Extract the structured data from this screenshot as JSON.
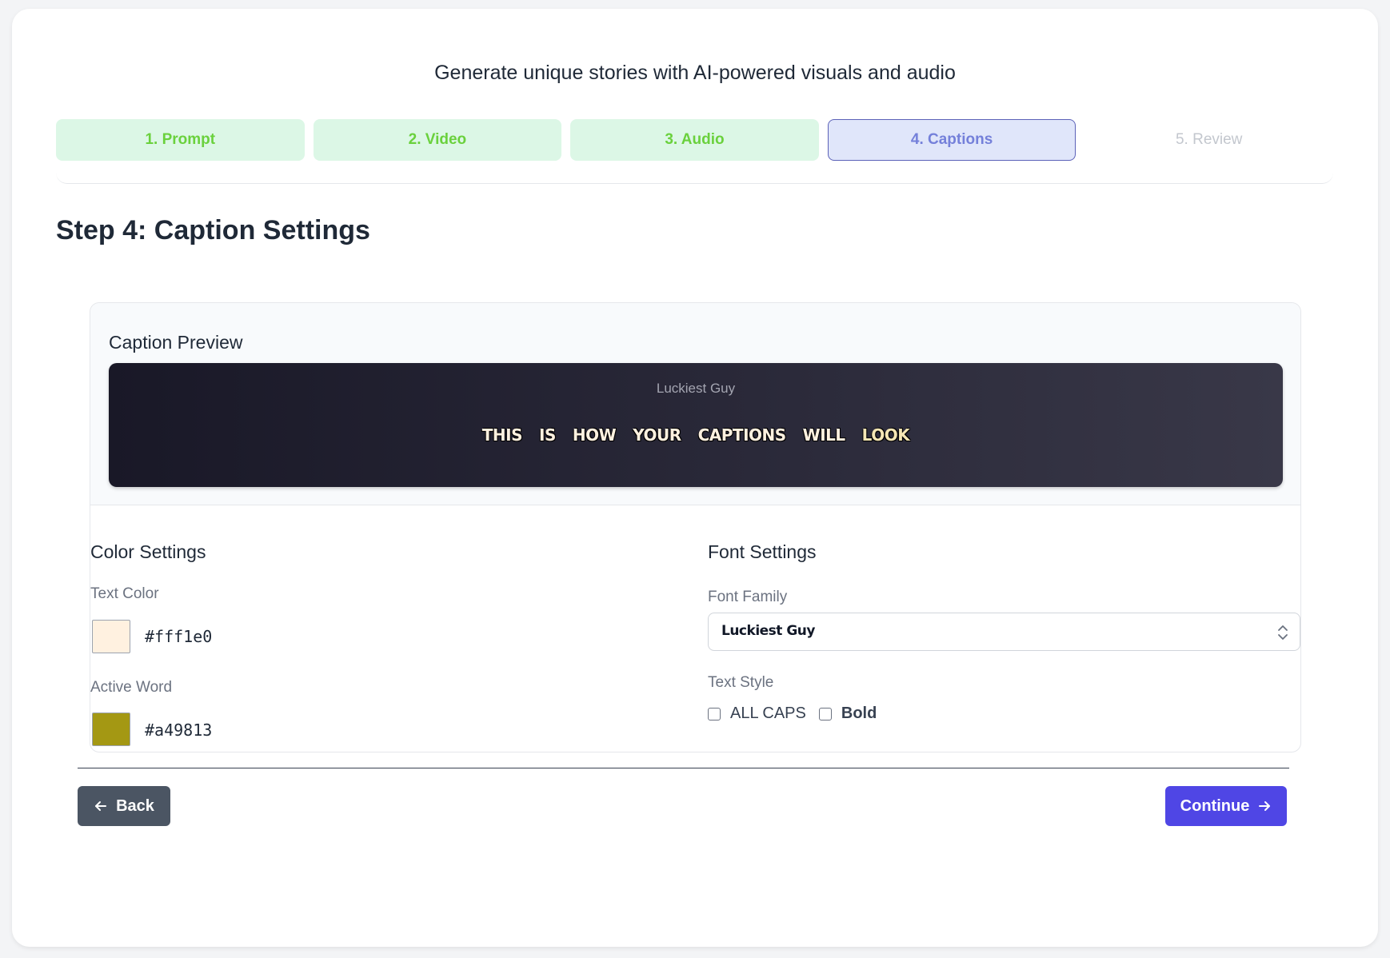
{
  "header": {
    "subtitle": "Generate unique stories with AI-powered visuals and audio"
  },
  "stepper": {
    "steps": [
      {
        "label": "1. Prompt",
        "state": "done"
      },
      {
        "label": "2. Video",
        "state": "done"
      },
      {
        "label": "3. Audio",
        "state": "done"
      },
      {
        "label": "4. Captions",
        "state": "active"
      },
      {
        "label": "5. Review",
        "state": "pending"
      }
    ]
  },
  "page": {
    "heading": "Step 4: Caption Settings"
  },
  "preview": {
    "title": "Caption Preview",
    "font_name": "Luckiest Guy",
    "words": [
      "THIS",
      "IS",
      "HOW",
      "YOUR",
      "CAPTIONS",
      "WILL",
      "LOOK"
    ],
    "active_word_index": 6
  },
  "color_settings": {
    "title": "Color Settings",
    "text_color_label": "Text Color",
    "text_color_value": "#fff1e0",
    "active_word_label": "Active Word",
    "active_word_value": "#a49813"
  },
  "font_settings": {
    "title": "Font Settings",
    "family_label": "Font Family",
    "family_value": "Luckiest Guy",
    "style_label": "Text Style",
    "all_caps_label": "ALL CAPS",
    "all_caps_checked": false,
    "bold_label": "Bold",
    "bold_checked": false
  },
  "actions": {
    "back_label": "Back",
    "continue_label": "Continue"
  },
  "colors": {
    "accent": "#4f46e5",
    "back_button": "#4b5563",
    "step_done": "#dcf7e6",
    "step_active": "#e0e6fa"
  },
  "icons": {
    "back": "arrow-left-icon",
    "continue": "arrow-right-icon",
    "select": "chevron-up-down-icon"
  }
}
